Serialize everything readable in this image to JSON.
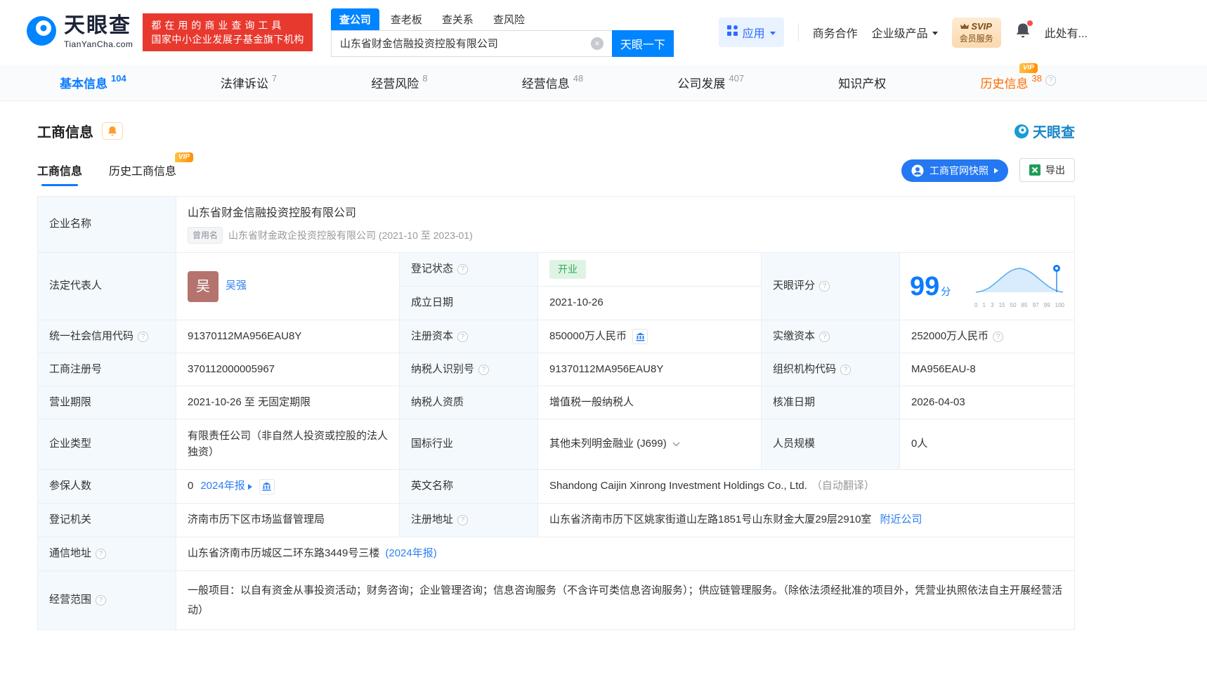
{
  "ui": {
    "vip": "VIP"
  },
  "header": {
    "logo": {
      "name": "天眼查",
      "domain": "TianYanCha.com"
    },
    "promo": {
      "line1": "都在用的商业查询工具",
      "line2": "国家中小企业发展子基金旗下机构"
    },
    "search": {
      "tabs": [
        {
          "label": "查公司"
        },
        {
          "label": "查老板"
        },
        {
          "label": "查关系"
        },
        {
          "label": "查风险"
        }
      ],
      "value": "山东省财金信融投资控股有限公司",
      "button": "天眼一下"
    },
    "right": {
      "apps": "应用",
      "cooperation": "商务合作",
      "enterprise": "企业级产品",
      "svip_line1": "SVIP",
      "svip_line2": "会员服务",
      "more": "此处有..."
    }
  },
  "nav": {
    "tabs": [
      {
        "label": "基本信息",
        "count": "104"
      },
      {
        "label": "法律诉讼",
        "count": "7"
      },
      {
        "label": "经营风险",
        "count": "8"
      },
      {
        "label": "经营信息",
        "count": "48"
      },
      {
        "label": "公司发展",
        "count": "407"
      },
      {
        "label": "知识产权",
        "count": ""
      },
      {
        "label": "历史信息",
        "count": "38"
      }
    ]
  },
  "section": {
    "title": "工商信息",
    "watermark": "天眼查",
    "subtabs": [
      {
        "label": "工商信息"
      },
      {
        "label": "历史工商信息"
      }
    ],
    "snapshot_button": "工商官网快照",
    "export_button": "导出"
  },
  "company": {
    "name_label": "企业名称",
    "name": "山东省财金信融投资控股有限公司",
    "former_name_tag": "曾用名",
    "former_name": "山东省财金政企投资控股有限公司 (2021-10 至 2023-01)",
    "legal_rep_label": "法定代表人",
    "legal_rep_avatar": "吴",
    "legal_rep_name": "吴强",
    "reg_status_label": "登记状态",
    "reg_status": "开业",
    "established_label": "成立日期",
    "established": "2021-10-26",
    "score_label": "天眼评分",
    "score": "99",
    "score_unit": "分",
    "score_axis": [
      "0",
      "1",
      "3",
      "15",
      "50",
      "85",
      "97",
      "99",
      "100"
    ],
    "credit_code_label": "统一社会信用代码",
    "credit_code": "91370112MA956EAU8Y",
    "reg_capital_label": "注册资本",
    "reg_capital": "850000万人民币",
    "paid_capital_label": "实缴资本",
    "paid_capital": "252000万人民币",
    "reg_no_label": "工商注册号",
    "reg_no": "370112000005967",
    "taxpayer_id_label": "纳税人识别号",
    "taxpayer_id": "91370112MA956EAU8Y",
    "org_code_label": "组织机构代码",
    "org_code": "MA956EAU-8",
    "term_label": "营业期限",
    "term": "2021-10-26 至 无固定期限",
    "taxpayer_quality_label": "纳税人资质",
    "taxpayer_quality": "增值税一般纳税人",
    "approve_date_label": "核准日期",
    "approve_date": "2026-04-03",
    "type_label": "企业类型",
    "type": "有限责任公司（非自然人投资或控股的法人独资）",
    "industry_label": "国标行业",
    "industry": "其他未列明金融业 (J699)",
    "staff_label": "人员规模",
    "staff": "0人",
    "insured_label": "参保人数",
    "insured": "0",
    "insured_report": "2024年报",
    "en_name_label": "英文名称",
    "en_name": "Shandong Caijin Xinrong Investment Holdings Co., Ltd.",
    "en_name_note": "（自动翻译）",
    "authority_label": "登记机关",
    "authority": "济南市历下区市场监督管理局",
    "address_label": "注册地址",
    "address": "山东省济南市历下区姚家街道山左路1851号山东财金大厦29层2910室",
    "nearby": "附近公司",
    "mail_label": "通信地址",
    "mail": "山东省济南市历城区二环东路3449号三楼",
    "mail_report": "(2024年报)",
    "scope_label": "经营范围",
    "scope": "一般项目：以自有资金从事投资活动；财务咨询；企业管理咨询；信息咨询服务（不含许可类信息咨询服务）；供应链管理服务。（除依法须经批准的项目外，凭营业执照依法自主开展经营活动）"
  }
}
